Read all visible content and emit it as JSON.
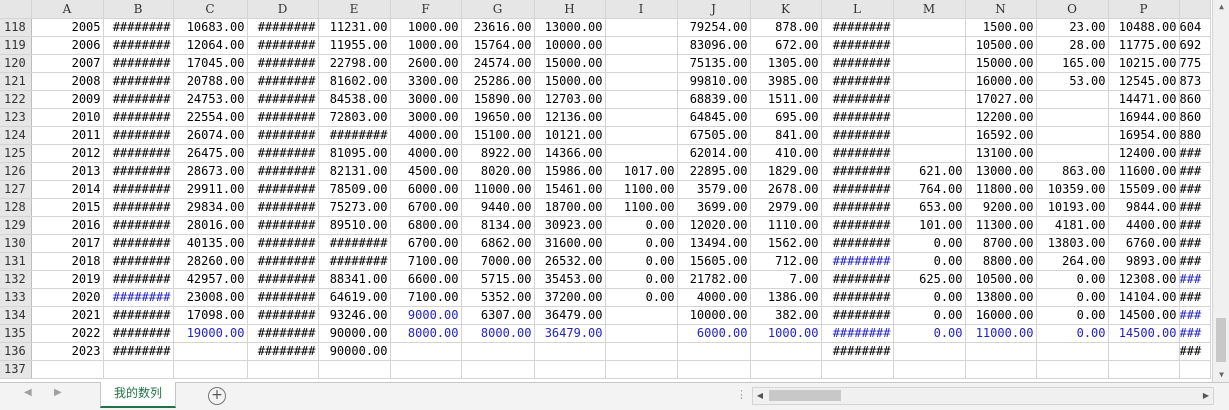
{
  "spreadsheet": {
    "columns": [
      "A",
      "B",
      "C",
      "D",
      "E",
      "F",
      "G",
      "H",
      "I",
      "J",
      "K",
      "L",
      "M",
      "N",
      "O",
      "P"
    ],
    "rows": [
      {
        "n": "118",
        "cells": [
          "2005",
          "########",
          "10683.00",
          "########",
          "11231.00",
          "1000.00",
          "23616.00",
          "13000.00",
          "",
          "79254.00",
          "878.00",
          "########",
          "",
          "1500.00",
          "23.00",
          "10488.00",
          "604"
        ]
      },
      {
        "n": "119",
        "cells": [
          "2006",
          "########",
          "12064.00",
          "########",
          "11955.00",
          "1000.00",
          "15764.00",
          "10000.00",
          "",
          "83096.00",
          "672.00",
          "########",
          "",
          "10500.00",
          "28.00",
          "11775.00",
          "692"
        ]
      },
      {
        "n": "120",
        "cells": [
          "2007",
          "########",
          "17045.00",
          "########",
          "22798.00",
          "2600.00",
          "24574.00",
          "15000.00",
          "",
          "75135.00",
          "1305.00",
          "########",
          "",
          "15000.00",
          "165.00",
          "10215.00",
          "775"
        ]
      },
      {
        "n": "121",
        "cells": [
          "2008",
          "########",
          "20788.00",
          "########",
          "81602.00",
          "3300.00",
          "25286.00",
          "15000.00",
          "",
          "99810.00",
          "3985.00",
          "########",
          "",
          "16000.00",
          "53.00",
          "12545.00",
          "873"
        ]
      },
      {
        "n": "122",
        "cells": [
          "2009",
          "########",
          "24753.00",
          "########",
          "84538.00",
          "3000.00",
          "15890.00",
          "12703.00",
          "",
          "68839.00",
          "1511.00",
          "########",
          "",
          "17027.00",
          "",
          "14471.00",
          "860"
        ]
      },
      {
        "n": "123",
        "cells": [
          "2010",
          "########",
          "22554.00",
          "########",
          "72803.00",
          "3000.00",
          "19650.00",
          "12136.00",
          "",
          "64845.00",
          "695.00",
          "########",
          "",
          "12200.00",
          "",
          "16944.00",
          "860"
        ]
      },
      {
        "n": "124",
        "cells": [
          "2011",
          "########",
          "26074.00",
          "########",
          "########",
          "4000.00",
          "15100.00",
          "10121.00",
          "",
          "67505.00",
          "841.00",
          "########",
          "",
          "16592.00",
          "",
          "16954.00",
          "880"
        ]
      },
      {
        "n": "125",
        "cells": [
          "2012",
          "########",
          "26475.00",
          "########",
          "81095.00",
          "4000.00",
          "8922.00",
          "14366.00",
          "",
          "62014.00",
          "410.00",
          "########",
          "",
          "13100.00",
          "",
          "12400.00",
          "###"
        ]
      },
      {
        "n": "126",
        "cells": [
          "2013",
          "########",
          "28673.00",
          "########",
          "82131.00",
          "4500.00",
          "8020.00",
          "15986.00",
          "1017.00",
          "22895.00",
          "1829.00",
          "########",
          "621.00",
          "13000.00",
          "863.00",
          "11600.00",
          "###"
        ]
      },
      {
        "n": "127",
        "cells": [
          "2014",
          "########",
          "29911.00",
          "########",
          "78509.00",
          "6000.00",
          "11000.00",
          "15461.00",
          "1100.00",
          "3579.00",
          "2678.00",
          "########",
          "764.00",
          "11800.00",
          "10359.00",
          "15509.00",
          "###"
        ]
      },
      {
        "n": "128",
        "cells": [
          "2015",
          "########",
          "29834.00",
          "########",
          "75273.00",
          "6700.00",
          "9440.00",
          "18700.00",
          "1100.00",
          "3699.00",
          "2979.00",
          "########",
          "653.00",
          "9200.00",
          "10193.00",
          "9844.00",
          "###"
        ]
      },
      {
        "n": "129",
        "cells": [
          "2016",
          "########",
          "28016.00",
          "########",
          "89510.00",
          "6800.00",
          "8134.00",
          "30923.00",
          "0.00",
          "12020.00",
          "1110.00",
          "########",
          "101.00",
          "11300.00",
          "4181.00",
          "4400.00",
          "###"
        ]
      },
      {
        "n": "130",
        "cells": [
          "2017",
          "########",
          "40135.00",
          "########",
          "########",
          "6700.00",
          "6862.00",
          "31600.00",
          "0.00",
          "13494.00",
          "1562.00",
          "########",
          "0.00",
          "8700.00",
          "13803.00",
          "6760.00",
          "###"
        ]
      },
      {
        "n": "131",
        "cells": [
          "2018",
          "########",
          "28260.00",
          "########",
          "########",
          "7100.00",
          "7000.00",
          "26532.00",
          "0.00",
          "15605.00",
          "712.00",
          "########",
          "0.00",
          "8800.00",
          "264.00",
          "9893.00",
          "###"
        ],
        "blue": [
          11
        ]
      },
      {
        "n": "132",
        "cells": [
          "2019",
          "########",
          "42957.00",
          "########",
          "88341.00",
          "6600.00",
          "5715.00",
          "35453.00",
          "0.00",
          "21782.00",
          "7.00",
          "########",
          "625.00",
          "10500.00",
          "0.00",
          "12308.00",
          "###"
        ],
        "blue": [
          16
        ]
      },
      {
        "n": "133",
        "cells": [
          "2020",
          "########",
          "23008.00",
          "########",
          "64619.00",
          "7100.00",
          "5352.00",
          "37200.00",
          "0.00",
          "4000.00",
          "1386.00",
          "########",
          "0.00",
          "13800.00",
          "0.00",
          "14104.00",
          "###"
        ],
        "blue": [
          1
        ]
      },
      {
        "n": "134",
        "cells": [
          "2021",
          "########",
          "17098.00",
          "########",
          "93246.00",
          "9000.00",
          "6307.00",
          "36479.00",
          "",
          "10000.00",
          "382.00",
          "########",
          "0.00",
          "16000.00",
          "0.00",
          "14500.00",
          "###"
        ],
        "blue": [
          5,
          16
        ]
      },
      {
        "n": "135",
        "cells": [
          "2022",
          "########",
          "19000.00",
          "########",
          "90000.00",
          "8000.00",
          "8000.00",
          "36479.00",
          "",
          "6000.00",
          "1000.00",
          "########",
          "0.00",
          "11000.00",
          "0.00",
          "14500.00",
          "###"
        ],
        "blue": [
          2,
          5,
          6,
          7,
          9,
          10,
          11,
          12,
          13,
          14,
          15,
          16
        ]
      },
      {
        "n": "136",
        "cells": [
          "2023",
          "########",
          "",
          "########",
          "90000.00",
          "",
          "",
          "",
          "",
          "",
          "",
          "########",
          "",
          "",
          "",
          "",
          "###"
        ]
      },
      {
        "n": "137",
        "cells": [
          "",
          "",
          "",
          "",
          "",
          "",
          "",
          "",
          "",
          "",
          "",
          "",
          "",
          "",
          "",
          "",
          ""
        ]
      }
    ]
  },
  "sheet_tabs": {
    "active_label": "我的数列",
    "add_icon": "plus-circle-icon",
    "nav_prev_icon": "triangle-left-icon",
    "nav_next_icon": "triangle-right-icon",
    "separator": "⋮"
  },
  "colors": {
    "blue_value": "#2222c8",
    "tab_accent": "#217346"
  }
}
